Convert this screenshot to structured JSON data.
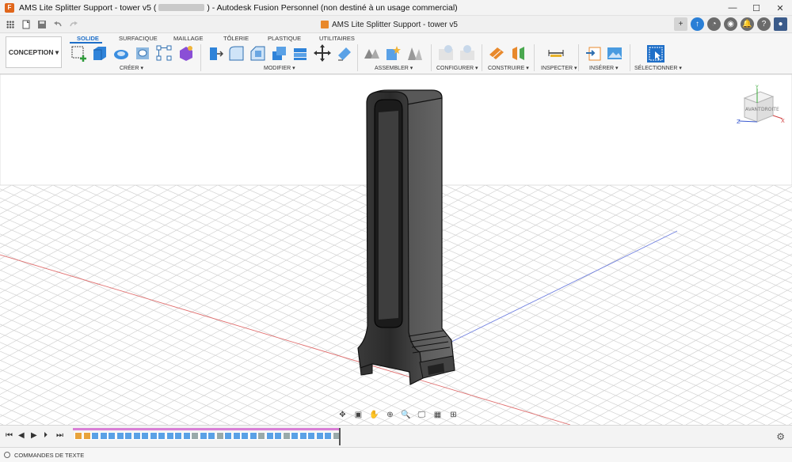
{
  "window": {
    "title_prefix": "AMS Lite Splitter Support - tower v5 (",
    "title_suffix": ") - Autodesk Fusion Personnel (non destiné à un usage commercial)",
    "minimize": "—",
    "maximize": "☐",
    "close": "✕"
  },
  "document_tab": {
    "label": "AMS Lite Splitter Support - tower v5",
    "close": "✕"
  },
  "workspace": {
    "label": "CONCEPTION ▾"
  },
  "tabs": [
    "SOLIDE",
    "SURFACIQUE",
    "MAILLAGE",
    "TÔLERIE",
    "PLASTIQUE",
    "UTILITAIRES"
  ],
  "groups": {
    "create": "CRÉER ▾",
    "modify": "MODIFIER ▾",
    "assemble": "ASSEMBLER ▾",
    "configure": "CONFIGURER ▾",
    "construct": "CONSTRUIRE ▾",
    "inspect": "INSPECTER ▾",
    "insert": "INSÉRER ▾",
    "select": "SÉLECTIONNER ▾"
  },
  "viewcube": {
    "front": "AVANT",
    "right": "DROITE",
    "axis_z": "Z",
    "axis_x": "X",
    "axis_y": "Y"
  },
  "text_commands": {
    "label": "COMMANDES DE TEXTE"
  },
  "colors": {
    "accent": "#1f6fc8",
    "timeline_track": "#d97fd6",
    "model": "#2f2f2f"
  },
  "icons": {
    "app": "fusion-app-icon",
    "settings": "gear-icon"
  }
}
